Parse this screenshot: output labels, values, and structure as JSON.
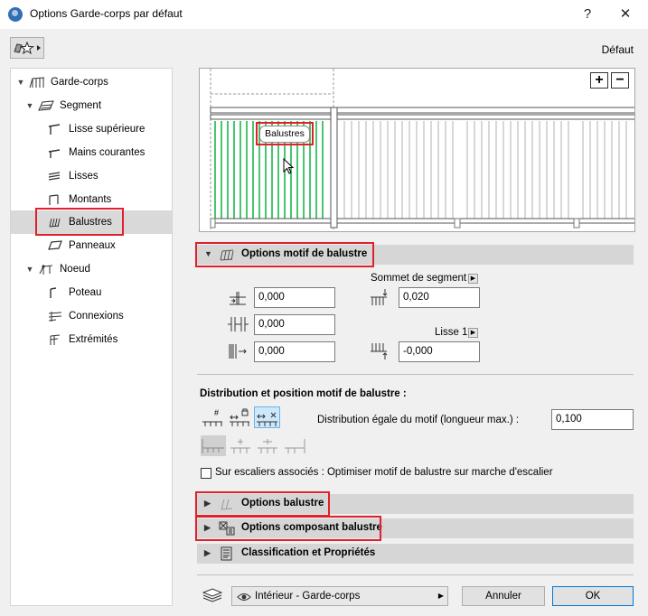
{
  "window": {
    "title": "Options Garde-corps par défaut",
    "help_label": "?",
    "close_label": "✕"
  },
  "header": {
    "default_label": "Défaut"
  },
  "tree": {
    "items": [
      {
        "label": "Garde-corps"
      },
      {
        "label": "Segment"
      },
      {
        "label": "Lisse supérieure"
      },
      {
        "label": "Mains courantes"
      },
      {
        "label": "Lisses"
      },
      {
        "label": "Montants"
      },
      {
        "label": "Balustres"
      },
      {
        "label": "Panneaux"
      },
      {
        "label": "Noeud"
      },
      {
        "label": "Poteau"
      },
      {
        "label": "Connexions"
      },
      {
        "label": "Extrémités"
      }
    ]
  },
  "preview": {
    "zoom_in": "+",
    "zoom_out": "−",
    "tooltip": "Balustres"
  },
  "pattern_options": {
    "title": "Options motif de balustre",
    "segment_top_label": "Sommet de segment",
    "rail1_label": "Lisse 1",
    "left_values": [
      "0,000",
      "0,000",
      "0,000"
    ],
    "top_offset": "0,020",
    "bottom_offset": "-0,000"
  },
  "distribution": {
    "title": "Distribution et position motif de balustre :",
    "equal_label": "Distribution égale du motif (longueur max.) :",
    "equal_value": "0,100",
    "stairs_label": "Sur escaliers associés : Optimiser motif de balustre sur marche d'escalier"
  },
  "sections": {
    "baluster_options": "Options balustre",
    "component_options": "Options composant balustre",
    "classification": "Classification et Propriétés"
  },
  "footer": {
    "layer_select": "Intérieur - Garde-corps",
    "cancel": "Annuler",
    "ok": "OK"
  },
  "colors": {
    "highlight_red": "#e0202a",
    "baluster_green": "#19b84a",
    "section_bar": "#d6d6d6",
    "selected_row": "#d9d9d9"
  }
}
